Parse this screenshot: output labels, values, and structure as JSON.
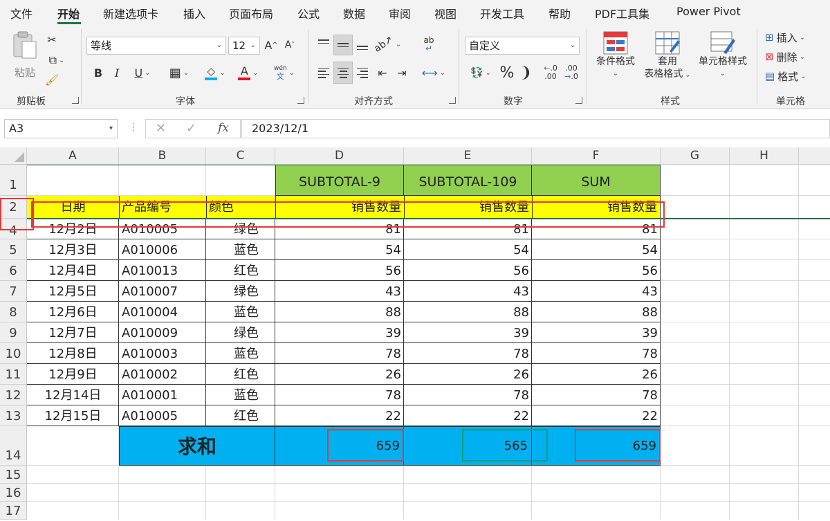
{
  "menu": {
    "tabs": [
      "文件",
      "开始",
      "新建选项卡",
      "插入",
      "页面布局",
      "公式",
      "数据",
      "审阅",
      "视图",
      "开发工具",
      "帮助",
      "PDF工具集",
      "Power Pivot"
    ],
    "active": "开始"
  },
  "ribbon": {
    "clipboard": {
      "paste_label": "粘贴",
      "group_label": "剪贴板"
    },
    "font": {
      "font_name": "等线",
      "font_size": "12",
      "bold": "B",
      "italic": "I",
      "underline": "U",
      "font_color_glyph": "A",
      "phonetic_top": "wén",
      "phonetic_bottom": "文",
      "grow": "A",
      "shrink": "A",
      "group_label": "字体"
    },
    "alignment": {
      "group_label": "对齐方式",
      "wrap_glyph": "ab"
    },
    "number": {
      "format": "自定义",
      "percent": "%",
      "comma": "❩",
      "inc_decimal": ".0",
      "dec_decimal": ".00",
      "group_label": "数字"
    },
    "styles": {
      "cond_format": "条件格式",
      "table_format_1": "套用",
      "table_format_2": "表格格式",
      "cell_styles": "单元格样式",
      "group_label": "样式"
    },
    "cells": {
      "insert": "插入",
      "delete": "删除",
      "format": "格式",
      "group_label": "单元格"
    }
  },
  "formula_bar": {
    "name_box": "A3",
    "fx": "fx",
    "formula": "2023/12/1"
  },
  "sheet": {
    "columns": [
      "A",
      "B",
      "C",
      "D",
      "E",
      "F",
      "G",
      "H"
    ],
    "row_numbers": [
      "1",
      "2",
      "4",
      "5",
      "6",
      "7",
      "8",
      "9",
      "10",
      "11",
      "12",
      "13",
      "14",
      "15",
      "16",
      "17"
    ],
    "row1": {
      "d": "SUBTOTAL-9",
      "e": "SUBTOTAL-109",
      "f": "SUM"
    },
    "header": {
      "a": "日期",
      "b": "产品编号",
      "c": "颜色",
      "d": "销售数量",
      "e": "销售数量",
      "f": "销售数量"
    },
    "rows": [
      {
        "date": "12月2日",
        "code": "A010005",
        "color": "绿色",
        "d": "81",
        "e": "81",
        "f": "81"
      },
      {
        "date": "12月3日",
        "code": "A010006",
        "color": "蓝色",
        "d": "54",
        "e": "54",
        "f": "54"
      },
      {
        "date": "12月4日",
        "code": "A010013",
        "color": "红色",
        "d": "56",
        "e": "56",
        "f": "56"
      },
      {
        "date": "12月5日",
        "code": "A010007",
        "color": "绿色",
        "d": "43",
        "e": "43",
        "f": "43"
      },
      {
        "date": "12月6日",
        "code": "A010004",
        "color": "蓝色",
        "d": "88",
        "e": "88",
        "f": "88"
      },
      {
        "date": "12月7日",
        "code": "A010009",
        "color": "绿色",
        "d": "39",
        "e": "39",
        "f": "39"
      },
      {
        "date": "12月8日",
        "code": "A010003",
        "color": "蓝色",
        "d": "78",
        "e": "78",
        "f": "78"
      },
      {
        "date": "12月9日",
        "code": "A010002",
        "color": "红色",
        "d": "26",
        "e": "26",
        "f": "26"
      },
      {
        "date": "12月14日",
        "code": "A010001",
        "color": "蓝色",
        "d": "78",
        "e": "78",
        "f": "78"
      },
      {
        "date": "12月15日",
        "code": "A010005",
        "color": "红色",
        "d": "22",
        "e": "22",
        "f": "22"
      }
    ],
    "total": {
      "label": "求和",
      "d": "659",
      "e": "565",
      "f": "659"
    }
  },
  "colors": {
    "accent": "#217346",
    "header_green": "#92d050",
    "header_yellow": "#ffff00",
    "total_blue": "#00b0f0",
    "highlight_red": "#e53935",
    "highlight_teal": "#169e7a"
  }
}
